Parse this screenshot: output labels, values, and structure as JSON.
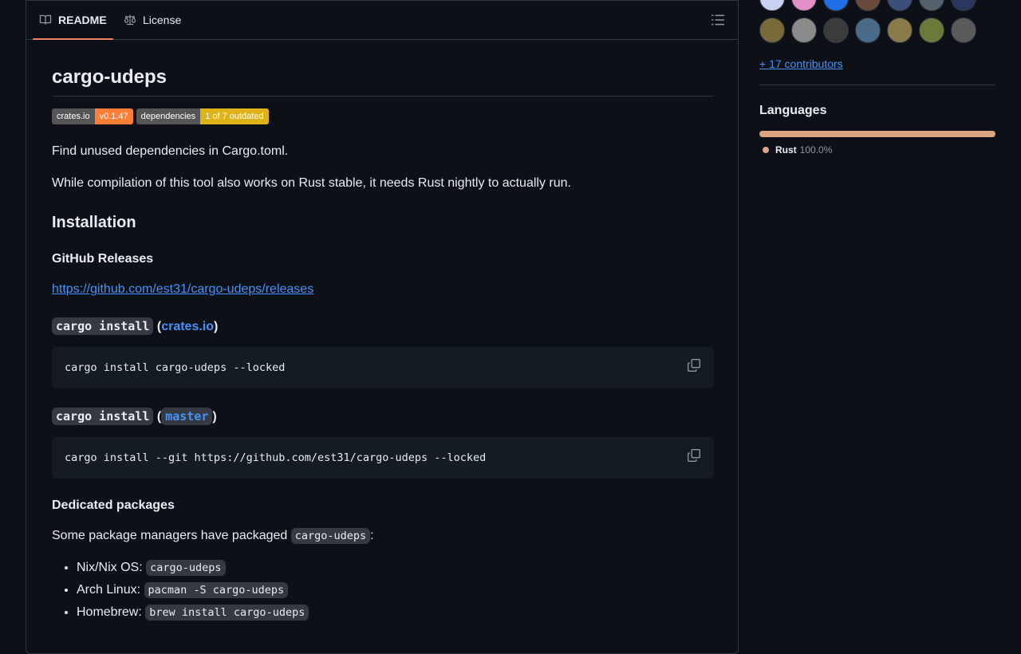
{
  "tabs": {
    "readme": "README",
    "license": "License"
  },
  "readme": {
    "title": "cargo-udeps",
    "badges": [
      {
        "label": "crates.io",
        "value": "v0.1.47",
        "color": "#fe7d37"
      },
      {
        "label": "dependencies",
        "value": "1 of 7 outdated",
        "color": "#dfb317"
      }
    ],
    "intro": "Find unused dependencies in Cargo.toml.",
    "note": "While compilation of this tool also works on Rust stable, it needs Rust nightly to actually run.",
    "installation_heading": "Installation",
    "github_releases_heading": "GitHub Releases",
    "releases_url": "https://github.com/est31/cargo-udeps/releases",
    "cargo_install_code": "cargo install",
    "crates_io_link": "crates.io",
    "crates_cmd": "cargo install cargo-udeps --locked",
    "master_link": "master",
    "master_cmd": "cargo install --git https://github.com/est31/cargo-udeps --locked",
    "dedicated_heading": "Dedicated packages",
    "packaged_text": "Some package managers have packaged",
    "packaged_code": "cargo-udeps",
    "packaged_suffix": ":",
    "packages": [
      {
        "label": "Nix/Nix OS:",
        "code": "cargo-udeps"
      },
      {
        "label": "Arch Linux:",
        "code": "pacman -S cargo-udeps"
      },
      {
        "label": "Homebrew:",
        "code": "brew install cargo-udeps"
      }
    ]
  },
  "sidebar": {
    "contributors_link": "+ 17 contributors",
    "languages_heading": "Languages",
    "languages": [
      {
        "name": "Rust",
        "percent": "100.0%",
        "share": 1.0,
        "color": "#dea584"
      }
    ]
  },
  "colors": {
    "accent": "#4493f8",
    "tab_underline": "#f78166",
    "background": "#0d1117"
  }
}
